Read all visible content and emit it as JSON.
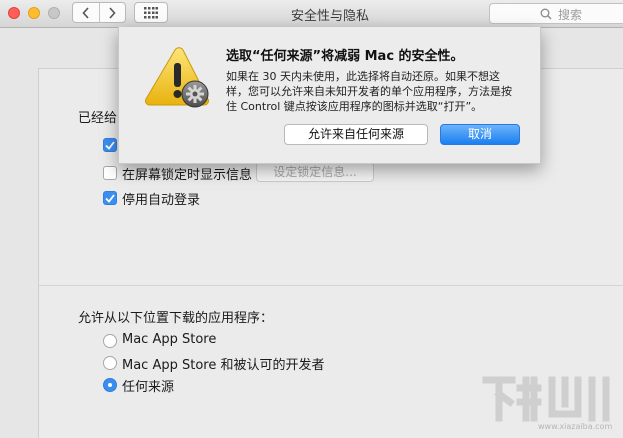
{
  "window": {
    "title": "安全性与隐私",
    "search_placeholder": "搜索"
  },
  "general": {
    "login_heading_partial": "已经给",
    "show_message_label": "在屏幕锁定时显示信息",
    "set_lock_message_button": "设定锁定信息...",
    "disable_auto_login_label": "停用自动登录"
  },
  "download": {
    "heading": "允许从以下位置下载的应用程序：",
    "options": [
      {
        "label": "Mac App Store",
        "selected": false
      },
      {
        "label": "Mac App Store 和被认可的开发者",
        "selected": false
      },
      {
        "label": "任何来源",
        "selected": true
      }
    ]
  },
  "alert": {
    "title": "选取“任何来源”将减弱 Mac 的安全性。",
    "body_lines": [
      "如果在 30 天内未使用，此选择将自动还原。如果不想这",
      "样，您可以允许来自未知开发者的单个应用程序，方法是按",
      "住 Control 键点按该应用程序的图标并选取“打开”。"
    ],
    "allow_button": "允许来自任何来源",
    "cancel_button": "取消"
  },
  "watermark": {
    "url": "www.xiazaiba.com"
  },
  "colors": {
    "accent": "#3b8ef0",
    "close": "#ff5f57",
    "minimize": "#ffbd2e",
    "warning": "#f5c518"
  }
}
